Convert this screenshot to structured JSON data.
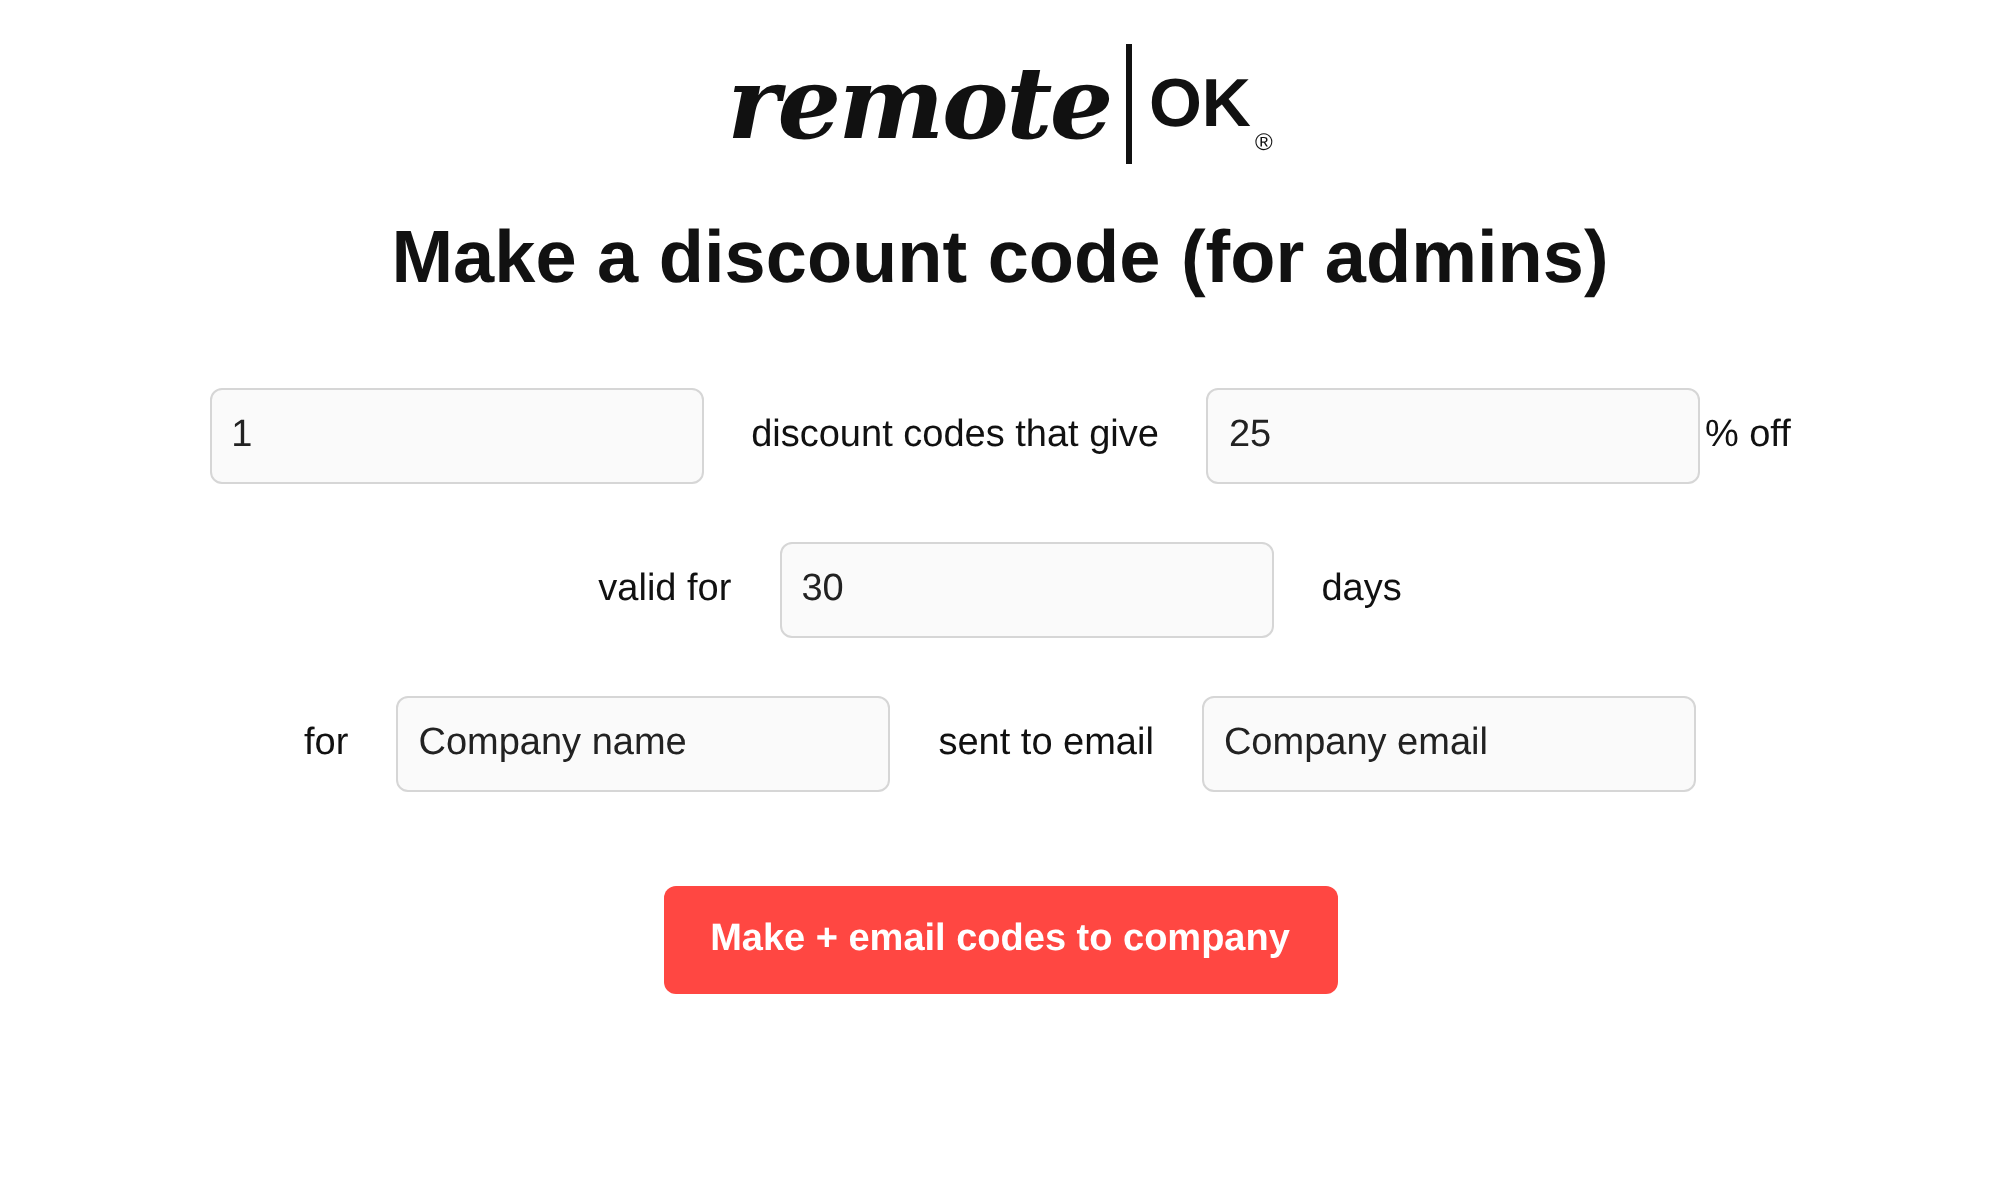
{
  "logo": {
    "wordmark": "remote",
    "suffix": "OK",
    "registered": "®"
  },
  "title": "Make a discount code (for admins)",
  "rows": [
    {
      "items": [
        {
          "kind": "field",
          "value": "1"
        },
        {
          "kind": "text",
          "text": "discount codes that give"
        },
        {
          "kind": "field",
          "value": "25",
          "suffix": "% off"
        }
      ]
    },
    {
      "items": [
        {
          "kind": "text",
          "text": "valid for"
        },
        {
          "kind": "field",
          "value": "30"
        },
        {
          "kind": "text",
          "text": "days"
        }
      ]
    },
    {
      "items": [
        {
          "kind": "text",
          "text": "for"
        },
        {
          "kind": "field",
          "placeholder": "Company name"
        },
        {
          "kind": "text",
          "text": "sent to email"
        },
        {
          "kind": "field",
          "placeholder": "Company email"
        }
      ]
    }
  ],
  "button": "Make + email codes to company"
}
